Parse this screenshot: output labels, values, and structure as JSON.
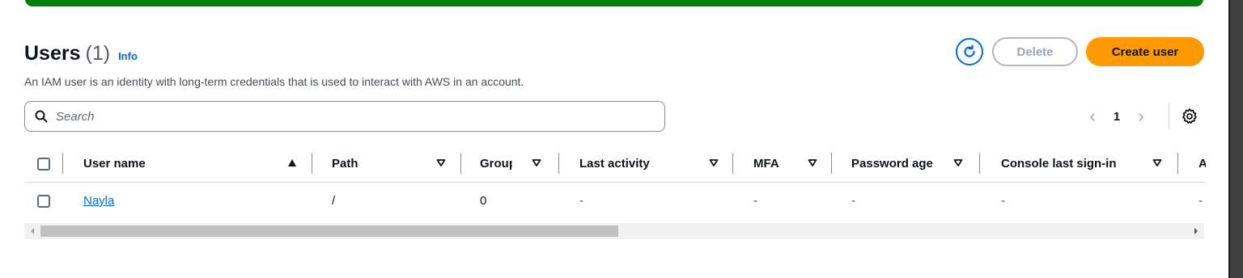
{
  "header": {
    "title": "Users",
    "count": "(1)",
    "info_label": "Info",
    "description": "An IAM user is an identity with long-term credentials that is used to interact with AWS in an account."
  },
  "actions": {
    "refresh_icon": "refresh-icon",
    "delete_label": "Delete",
    "create_label": "Create user"
  },
  "search": {
    "placeholder": "Search",
    "value": ""
  },
  "pagination": {
    "current_page": "1"
  },
  "table": {
    "columns": [
      "User name",
      "Path",
      "Groups",
      "Last activity",
      "MFA",
      "Password age",
      "Console last sign-in",
      "A"
    ],
    "rows": [
      {
        "user_name": "Nayla",
        "path": "/",
        "groups": "0",
        "last_activity": "-",
        "mfa": "-",
        "password_age": "-",
        "console_last_sign_in": "-",
        "extra": "-"
      }
    ]
  },
  "colors": {
    "accent_blue": "#006ce0",
    "primary_orange": "#ff9900",
    "success_banner": "#037f0c",
    "disabled_text": "#9ba7b6"
  }
}
